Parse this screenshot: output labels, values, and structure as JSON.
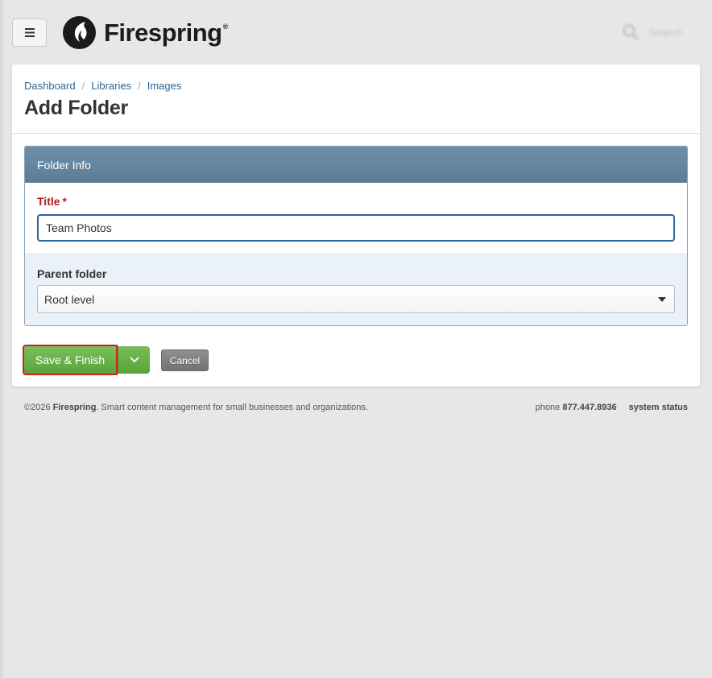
{
  "header": {
    "menu_icon": "hamburger-icon",
    "brand_name": "Firespring",
    "brand_registered": "®",
    "search_placeholder": "Search"
  },
  "breadcrumb": {
    "items": [
      "Dashboard",
      "Libraries",
      "Images"
    ],
    "separator": "/"
  },
  "page": {
    "title": "Add Folder"
  },
  "panel": {
    "header": "Folder Info",
    "title_label": "Title",
    "title_required": "*",
    "title_value": "Team Photos",
    "parent_label": "Parent folder",
    "parent_value": "Root level"
  },
  "actions": {
    "save_label": "Save & Finish",
    "cancel_label": "Cancel"
  },
  "footer": {
    "copyright": "©2026 ",
    "company": "Firespring",
    "tagline": ". Smart content management for small businesses and organizations.",
    "phone_label": "phone ",
    "phone_number": "877.447.8936",
    "status_link": "system status"
  },
  "colors": {
    "panel_header": "#5b7d98",
    "primary_button": "#5aa33a",
    "required_label": "#b01c1c",
    "link": "#2e6693",
    "focus_outline": "#2a63a3",
    "highlight_border": "#d21f1f"
  }
}
